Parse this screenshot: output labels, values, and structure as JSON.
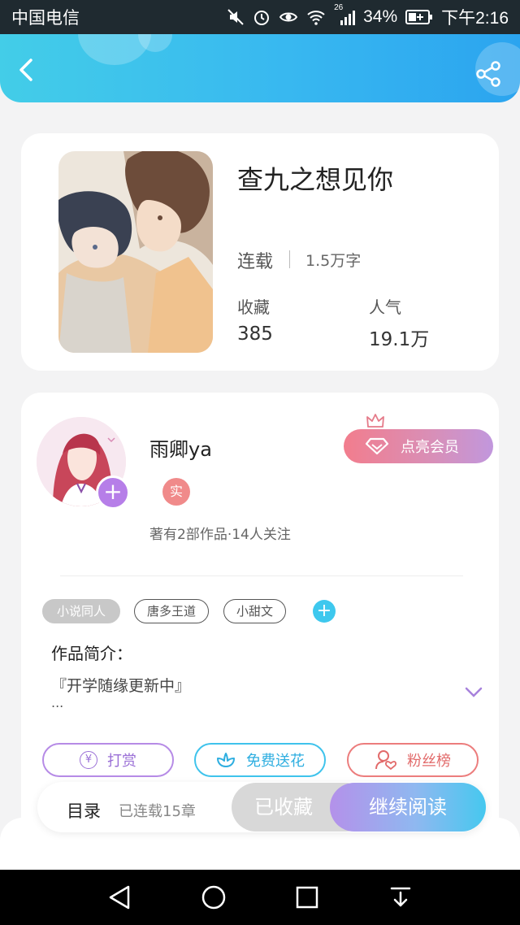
{
  "statusbar": {
    "carrier": "中国电信",
    "network": "26",
    "battery": "34%",
    "time": "下午2:16",
    "icons": [
      "mute-icon",
      "alarm-icon",
      "eye-icon",
      "wifi-icon",
      "signal-icon",
      "battery-icon"
    ]
  },
  "header": {
    "back_icon": "chevron-left-icon",
    "share_icon": "share-icon",
    "accent": "#38b8f0"
  },
  "book": {
    "title": "查九之想见你",
    "status": "连载",
    "words": "1.5万字",
    "favorites_label": "收藏",
    "favorites_value": "385",
    "popularity_label": "人气",
    "popularity_value": "19.1万"
  },
  "author": {
    "name": "雨卿ya",
    "verified_badge": "实",
    "meta": "著有2部作品·14人关注",
    "follow_symbol": "+",
    "vip_label": "点亮会员"
  },
  "tags": {
    "items": [
      "小说同人",
      "唐多王道",
      "小甜文"
    ],
    "add_symbol": "+"
  },
  "intro": {
    "label": "作品简介：",
    "text": "『开学随缘更新中』",
    "ellipsis": "..."
  },
  "actions": {
    "reward_symbol": "¥",
    "reward_label": "打赏",
    "flower_label": "免费送花",
    "fans_label": "粉丝榜"
  },
  "bottom": {
    "toc_label": "目录",
    "toc_count": "已连载15章",
    "collected_label": "已收藏",
    "read_label": "继续阅读"
  },
  "navbar": {
    "icons": [
      "back-triangle-icon",
      "home-circle-icon",
      "recent-square-icon",
      "notification-pull-icon"
    ]
  }
}
